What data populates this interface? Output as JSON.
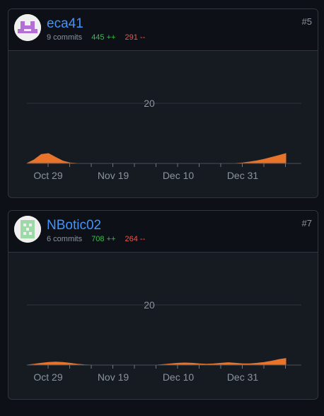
{
  "contributors": [
    {
      "username": "eca41",
      "commits": "9 commits",
      "additions": "445 ++",
      "deletions": "291 --",
      "rank": "#5",
      "avatar_icon": "identicon-purple",
      "avatar_color": "#b36fd6",
      "chart_data": {
        "type": "area",
        "x_tick_labels": [
          "Oct 29",
          "Nov 19",
          "Dec 10",
          "Dec 31"
        ],
        "y_tick_labels": [
          "20"
        ],
        "ylim": [
          0,
          20
        ],
        "grid": true,
        "color": "#e8742c",
        "series": [
          {
            "values": [
              0,
              1.2,
              3.0,
              3.3,
              2.0,
              0.8,
              0.2,
              0,
              0,
              0,
              0,
              0,
              0,
              0,
              0,
              0,
              0,
              0,
              0,
              0,
              0,
              0,
              0,
              0,
              0,
              0,
              0,
              0,
              0,
              0,
              0.2,
              0.5,
              0.9,
              1.4,
              2.0,
              2.6,
              3.3
            ]
          }
        ]
      }
    },
    {
      "username": "NBotic02",
      "commits": "6 commits",
      "additions": "708 ++",
      "deletions": "264 --",
      "rank": "#7",
      "avatar_icon": "identicon-green",
      "avatar_color": "#9ed9a8",
      "chart_data": {
        "type": "area",
        "x_tick_labels": [
          "Oct 29",
          "Nov 19",
          "Dec 10",
          "Dec 31"
        ],
        "y_tick_labels": [
          "20"
        ],
        "ylim": [
          0,
          20
        ],
        "grid": true,
        "color": "#e8742c",
        "series": [
          {
            "values": [
              0,
              0.3,
              0.6,
              0.9,
              1.0,
              0.9,
              0.6,
              0.3,
              0.1,
              0,
              0,
              0,
              0,
              0,
              0,
              0,
              0,
              0,
              0,
              0.2,
              0.4,
              0.6,
              0.7,
              0.6,
              0.4,
              0.3,
              0.4,
              0.6,
              0.8,
              0.6,
              0.4,
              0.4,
              0.6,
              0.9,
              1.3,
              1.8,
              2.2
            ]
          }
        ]
      }
    }
  ]
}
